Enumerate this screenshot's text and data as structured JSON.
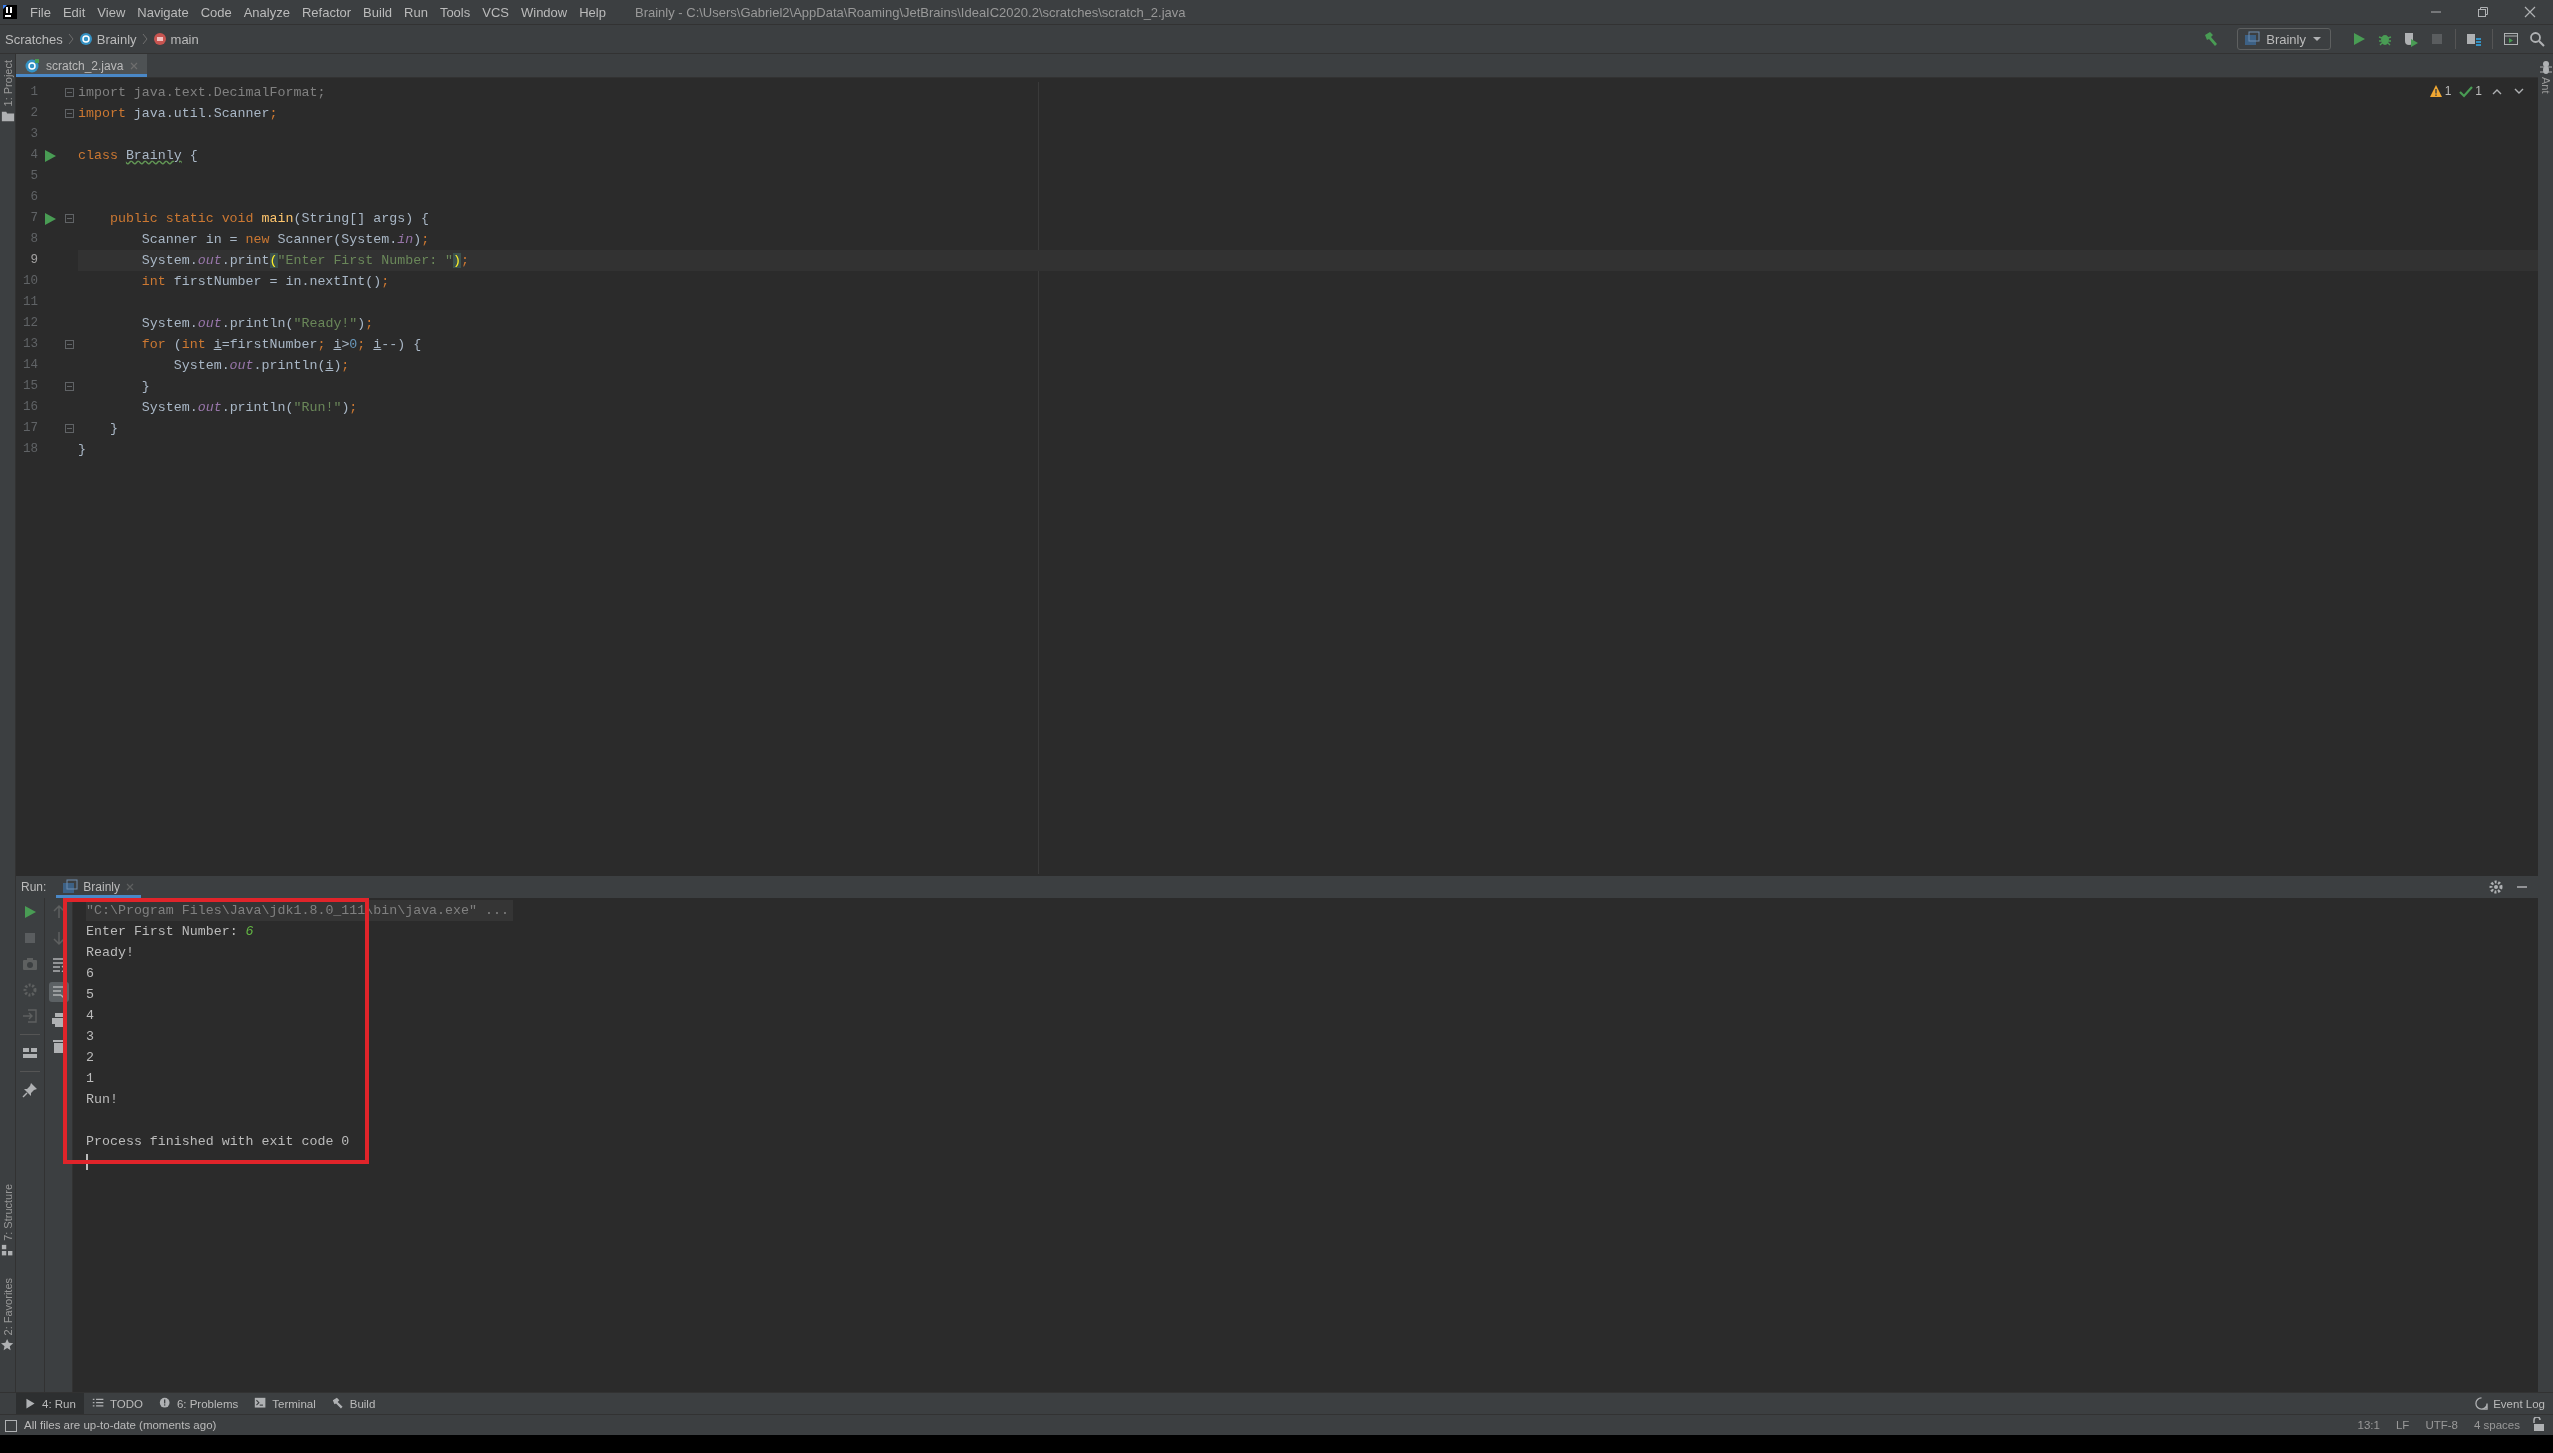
{
  "window": {
    "title": "Brainly - C:\\Users\\Gabriel2\\AppData\\Roaming\\JetBrains\\IdeaIC2020.2\\scratches\\scratch_2.java"
  },
  "menu": [
    "File",
    "Edit",
    "View",
    "Navigate",
    "Code",
    "Analyze",
    "Refactor",
    "Build",
    "Run",
    "Tools",
    "VCS",
    "Window",
    "Help"
  ],
  "breadcrumbs": [
    {
      "label": "Scratches",
      "kind": "folder"
    },
    {
      "label": "Brainly",
      "kind": "class"
    },
    {
      "label": "main",
      "kind": "method"
    }
  ],
  "toolbar": {
    "run_configuration": "Brainly",
    "stop": {
      "disabled": true
    }
  },
  "left_tool_strip": [
    {
      "label": "1: Project",
      "kind": "project"
    },
    {
      "label": "7: Structure",
      "kind": "structure"
    },
    {
      "label": "2: Favorites",
      "kind": "favorites"
    }
  ],
  "right_tool_strip": [
    {
      "label": "Ant"
    }
  ],
  "editor_tabs": [
    {
      "label": "scratch_2.java",
      "selected": true
    }
  ],
  "inspections": {
    "warnings": "1",
    "ok": "1"
  },
  "editor": {
    "lines": [
      {
        "number": "1",
        "current": false,
        "run_marker": false,
        "fold": true,
        "tokens": [
          {
            "text": "import java.text.DecimalFormat;",
            "kind": "unused"
          }
        ]
      },
      {
        "number": "2",
        "current": false,
        "run_marker": false,
        "fold": true,
        "tokens": [
          {
            "text": "import",
            "kind": "keyword"
          },
          {
            "text": " java.util.Scanner",
            "kind": "plain"
          },
          {
            "text": ";",
            "kind": "keyword"
          }
        ]
      },
      {
        "number": "3",
        "current": false,
        "run_marker": false,
        "fold": false
      },
      {
        "number": "4",
        "current": false,
        "run_marker": true,
        "fold": false,
        "tokens": [
          {
            "text": "class ",
            "kind": "keyword"
          },
          {
            "text": "Brainly",
            "kind": "typo"
          },
          {
            "text": " {",
            "kind": "plain"
          }
        ]
      },
      {
        "number": "5",
        "current": false,
        "run_marker": false,
        "fold": false
      },
      {
        "number": "6",
        "current": false,
        "run_marker": false,
        "fold": false
      },
      {
        "number": "7",
        "current": false,
        "run_marker": true,
        "fold": true,
        "tokens": [
          {
            "text": "    public static void ",
            "kind": "keyword"
          },
          {
            "text": "main",
            "kind": "declaration"
          },
          {
            "text": "(String[] args) {",
            "kind": "plain"
          }
        ]
      },
      {
        "number": "8",
        "current": false,
        "run_marker": false,
        "fold": false,
        "tokens": [
          {
            "text": "        Scanner in = ",
            "kind": "plain"
          },
          {
            "text": "new",
            "kind": "keyword"
          },
          {
            "text": " Scanner(System.",
            "kind": "plain"
          },
          {
            "text": "in",
            "kind": "field"
          },
          {
            "text": ")",
            "kind": "plain"
          },
          {
            "text": ";",
            "kind": "keyword"
          }
        ]
      },
      {
        "number": "9",
        "current": true,
        "run_marker": false,
        "fold": false,
        "tokens": [
          {
            "text": "        System.",
            "kind": "plain"
          },
          {
            "text": "out",
            "kind": "field"
          },
          {
            "text": ".print",
            "kind": "plain"
          },
          {
            "text": "(",
            "kind": "match"
          },
          {
            "text": "\"Enter First Number: \"",
            "kind": "string"
          },
          {
            "text": ")",
            "kind": "match"
          },
          {
            "text": ";",
            "kind": "keyword"
          }
        ]
      },
      {
        "number": "10",
        "current": false,
        "run_marker": false,
        "fold": false,
        "tokens": [
          {
            "text": "        int",
            "kind": "keyword"
          },
          {
            "text": " firstNumber = in.nextInt()",
            "kind": "plain"
          },
          {
            "text": ";",
            "kind": "keyword"
          }
        ]
      },
      {
        "number": "11",
        "current": false,
        "run_marker": false,
        "fold": false
      },
      {
        "number": "12",
        "current": false,
        "run_marker": false,
        "fold": false,
        "tokens": [
          {
            "text": "        System.",
            "kind": "plain"
          },
          {
            "text": "out",
            "kind": "field"
          },
          {
            "text": ".println(",
            "kind": "plain"
          },
          {
            "text": "\"Ready!\"",
            "kind": "string"
          },
          {
            "text": ")",
            "kind": "plain"
          },
          {
            "text": ";",
            "kind": "keyword"
          }
        ]
      },
      {
        "number": "13",
        "current": false,
        "run_marker": false,
        "fold": true,
        "tokens": [
          {
            "text": "        for",
            "kind": "keyword"
          },
          {
            "text": " (",
            "kind": "plain"
          },
          {
            "text": "int ",
            "kind": "keyword"
          },
          {
            "text": "i",
            "kind": "variable"
          },
          {
            "text": "=firstNumber",
            "kind": "plain"
          },
          {
            "text": "; ",
            "kind": "keyword"
          },
          {
            "text": "i",
            "kind": "variable"
          },
          {
            "text": ">",
            "kind": "plain"
          },
          {
            "text": "0",
            "kind": "number"
          },
          {
            "text": "; ",
            "kind": "keyword"
          },
          {
            "text": "i",
            "kind": "variable"
          },
          {
            "text": "--) {",
            "kind": "plain"
          }
        ]
      },
      {
        "number": "14",
        "current": false,
        "run_marker": false,
        "fold": false,
        "tokens": [
          {
            "text": "            System.",
            "kind": "plain"
          },
          {
            "text": "out",
            "kind": "field"
          },
          {
            "text": ".println(",
            "kind": "plain"
          },
          {
            "text": "i",
            "kind": "variable"
          },
          {
            "text": ")",
            "kind": "plain"
          },
          {
            "text": ";",
            "kind": "keyword"
          }
        ]
      },
      {
        "number": "15",
        "current": false,
        "run_marker": false,
        "fold": true,
        "tokens": [
          {
            "text": "        }",
            "kind": "plain"
          }
        ]
      },
      {
        "number": "16",
        "current": false,
        "run_marker": false,
        "fold": false,
        "tokens": [
          {
            "text": "        System.",
            "kind": "plain"
          },
          {
            "text": "out",
            "kind": "field"
          },
          {
            "text": ".println(",
            "kind": "plain"
          },
          {
            "text": "\"Run!\"",
            "kind": "string"
          },
          {
            "text": ")",
            "kind": "plain"
          },
          {
            "text": ";",
            "kind": "keyword"
          }
        ]
      },
      {
        "number": "17",
        "current": false,
        "run_marker": false,
        "fold": true,
        "tokens": [
          {
            "text": "    }",
            "kind": "plain"
          }
        ]
      },
      {
        "number": "18",
        "current": false,
        "run_marker": false,
        "fold": false,
        "tokens": [
          {
            "text": "}",
            "kind": "plain"
          }
        ]
      }
    ]
  },
  "run_panel": {
    "label": "Run:",
    "tabs": [
      {
        "label": "Brainly",
        "selected": true
      }
    ],
    "scroll_to_end": true,
    "console": [
      {
        "kind": "command",
        "text": "\"C:\\Program Files\\Java\\jdk1.8.0_111\\bin\\java.exe\" ..."
      },
      {
        "kind": "prompt",
        "text": "Enter First Number: ",
        "input": "6"
      },
      {
        "kind": "output",
        "text": "Ready!"
      },
      {
        "kind": "output",
        "text": "6"
      },
      {
        "kind": "output",
        "text": "5"
      },
      {
        "kind": "output",
        "text": "4"
      },
      {
        "kind": "output",
        "text": "3"
      },
      {
        "kind": "output",
        "text": "2"
      },
      {
        "kind": "output",
        "text": "1"
      },
      {
        "kind": "output",
        "text": "Run!"
      },
      {
        "kind": "blank"
      },
      {
        "kind": "output",
        "text": "Process finished with exit code 0"
      },
      {
        "kind": "cursor"
      }
    ],
    "annotation": {
      "kind": "rectangle",
      "color": "#e0242a"
    }
  },
  "tool_tabs": [
    {
      "label": "4: Run",
      "kind": "run",
      "selected": true
    },
    {
      "label": "TODO",
      "kind": "todo",
      "selected": false
    },
    {
      "label": "6: Problems",
      "kind": "problems",
      "selected": false
    },
    {
      "label": "Terminal",
      "kind": "terminal",
      "selected": false
    },
    {
      "label": "Build",
      "kind": "build",
      "selected": false
    }
  ],
  "event_log": "Event Log",
  "status_bar": {
    "message": "All files are up-to-date (moments ago)",
    "items": [
      "13:1",
      "LF",
      "UTF-8",
      "4 spaces"
    ]
  }
}
